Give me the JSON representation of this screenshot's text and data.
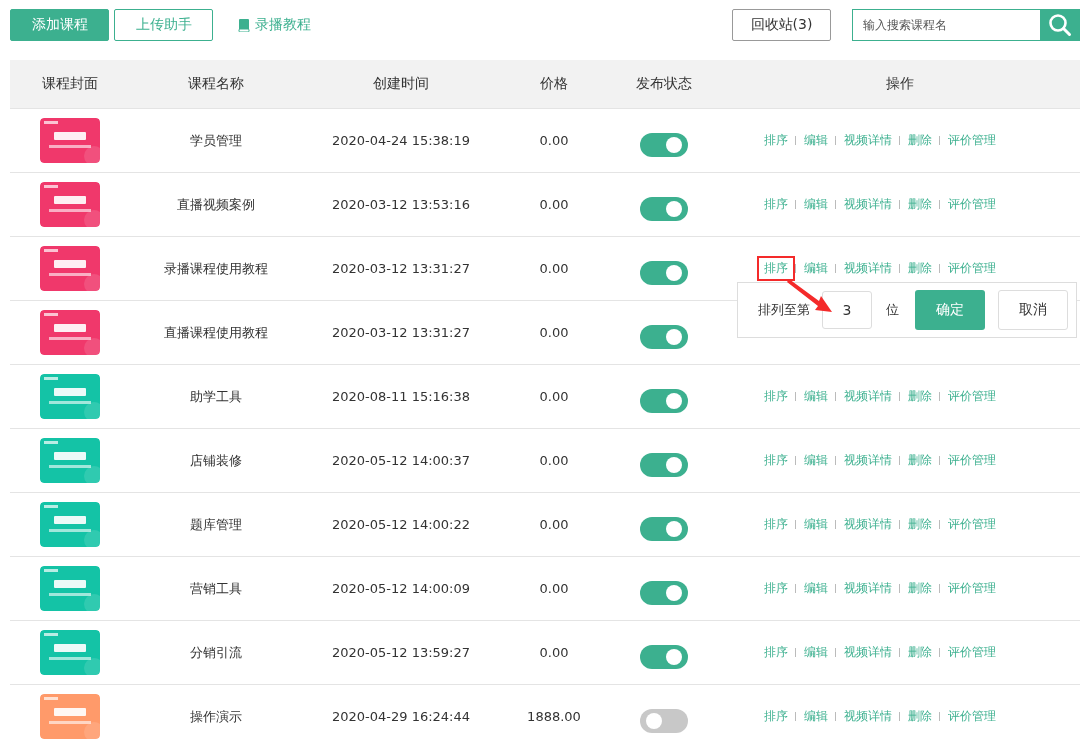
{
  "toolbar": {
    "add_button": "添加课程",
    "upload_button": "上传助手",
    "tutorial_link": "录播教程",
    "recycle_button": "回收站(3)",
    "search": {
      "placeholder": "输入搜索课程名"
    }
  },
  "table": {
    "columns": [
      "课程封面",
      "课程名称",
      "创建时间",
      "价格",
      "发布状态",
      "操作"
    ],
    "rows": [
      {
        "cover": {
          "kind": "picture",
          "color": "#f0386b"
        },
        "name": "学员管理",
        "created": "2020-04-24 15:38:19",
        "price": "0.00",
        "published": true,
        "actions": [
          {
            "label": "排序",
            "highlighted": false
          },
          {
            "label": "编辑",
            "highlighted": false
          },
          {
            "label": "视频详情",
            "highlighted": false
          },
          {
            "label": "删除",
            "highlighted": false
          },
          {
            "label": "评价管理",
            "highlighted": false
          }
        ]
      },
      {
        "cover": {
          "kind": "picture",
          "color": "#f0386b"
        },
        "name": "直播视频案例",
        "created": "2020-03-12 13:53:16",
        "price": "0.00",
        "published": true,
        "actions": [
          {
            "label": "排序",
            "highlighted": false
          },
          {
            "label": "编辑",
            "highlighted": false
          },
          {
            "label": "视频详情",
            "highlighted": false
          },
          {
            "label": "删除",
            "highlighted": false
          },
          {
            "label": "评价管理",
            "highlighted": false
          }
        ]
      },
      {
        "cover": {
          "kind": "picture",
          "color": "#f0386b"
        },
        "name": "录播课程使用教程",
        "created": "2020-03-12 13:31:27",
        "price": "0.00",
        "published": true,
        "actions": [
          {
            "label": "排序",
            "highlighted": true
          },
          {
            "label": "编辑",
            "highlighted": false
          },
          {
            "label": "视频详情",
            "highlighted": false
          },
          {
            "label": "删除",
            "highlighted": false
          },
          {
            "label": "评价管理",
            "highlighted": false
          }
        ],
        "sort_popup": {
          "label": "排列至第",
          "value": "3",
          "unit": "位",
          "confirm": "确定",
          "cancel": "取消"
        }
      },
      {
        "cover": {
          "kind": "picture",
          "color": "#f0386b"
        },
        "name": "直播课程使用教程",
        "created": "2020-03-12 13:31:27",
        "price": "0.00",
        "published": true
      },
      {
        "cover": {
          "kind": "picture",
          "color": "#14c3a6"
        },
        "name": "助学工具",
        "created": "2020-08-11 15:16:38",
        "price": "0.00",
        "published": true,
        "actions": [
          {
            "label": "排序",
            "highlighted": false
          },
          {
            "label": "编辑",
            "highlighted": false
          },
          {
            "label": "视频详情",
            "highlighted": false
          },
          {
            "label": "删除",
            "highlighted": false
          },
          {
            "label": "评价管理",
            "highlighted": false
          }
        ]
      },
      {
        "cover": {
          "kind": "picture",
          "color": "#14c3a6"
        },
        "name": "店铺装修",
        "created": "2020-05-12 14:00:37",
        "price": "0.00",
        "published": true,
        "actions": [
          {
            "label": "排序",
            "highlighted": false
          },
          {
            "label": "编辑",
            "highlighted": false
          },
          {
            "label": "视频详情",
            "highlighted": false
          },
          {
            "label": "删除",
            "highlighted": false
          },
          {
            "label": "评价管理",
            "highlighted": false
          }
        ]
      },
      {
        "cover": {
          "kind": "picture",
          "color": "#14c3a6"
        },
        "name": "题库管理",
        "created": "2020-05-12 14:00:22",
        "price": "0.00",
        "published": true,
        "actions": [
          {
            "label": "排序",
            "highlighted": false
          },
          {
            "label": "编辑",
            "highlighted": false
          },
          {
            "label": "视频详情",
            "highlighted": false
          },
          {
            "label": "删除",
            "highlighted": false
          },
          {
            "label": "评价管理",
            "highlighted": false
          }
        ]
      },
      {
        "cover": {
          "kind": "picture",
          "color": "#14c3a6"
        },
        "name": "营销工具",
        "created": "2020-05-12 14:00:09",
        "price": "0.00",
        "published": true,
        "actions": [
          {
            "label": "排序",
            "highlighted": false
          },
          {
            "label": "编辑",
            "highlighted": false
          },
          {
            "label": "视频详情",
            "highlighted": false
          },
          {
            "label": "删除",
            "highlighted": false
          },
          {
            "label": "评价管理",
            "highlighted": false
          }
        ]
      },
      {
        "cover": {
          "kind": "picture",
          "color": "#14c3a6"
        },
        "name": "分销引流",
        "created": "2020-05-12 13:59:27",
        "price": "0.00",
        "published": true,
        "actions": [
          {
            "label": "排序",
            "highlighted": false
          },
          {
            "label": "编辑",
            "highlighted": false
          },
          {
            "label": "视频详情",
            "highlighted": false
          },
          {
            "label": "删除",
            "highlighted": false
          },
          {
            "label": "评价管理",
            "highlighted": false
          }
        ]
      },
      {
        "cover": {
          "kind": "picture",
          "color": "#ff9a6a"
        },
        "name": "操作演示",
        "created": "2020-04-29 16:24:44",
        "price": "1888.00",
        "published": false,
        "actions": [
          {
            "label": "排序",
            "highlighted": false
          },
          {
            "label": "编辑",
            "highlighted": false
          },
          {
            "label": "视频详情",
            "highlighted": false
          },
          {
            "label": "删除",
            "highlighted": false
          },
          {
            "label": "评价管理",
            "highlighted": false
          }
        ]
      }
    ]
  }
}
